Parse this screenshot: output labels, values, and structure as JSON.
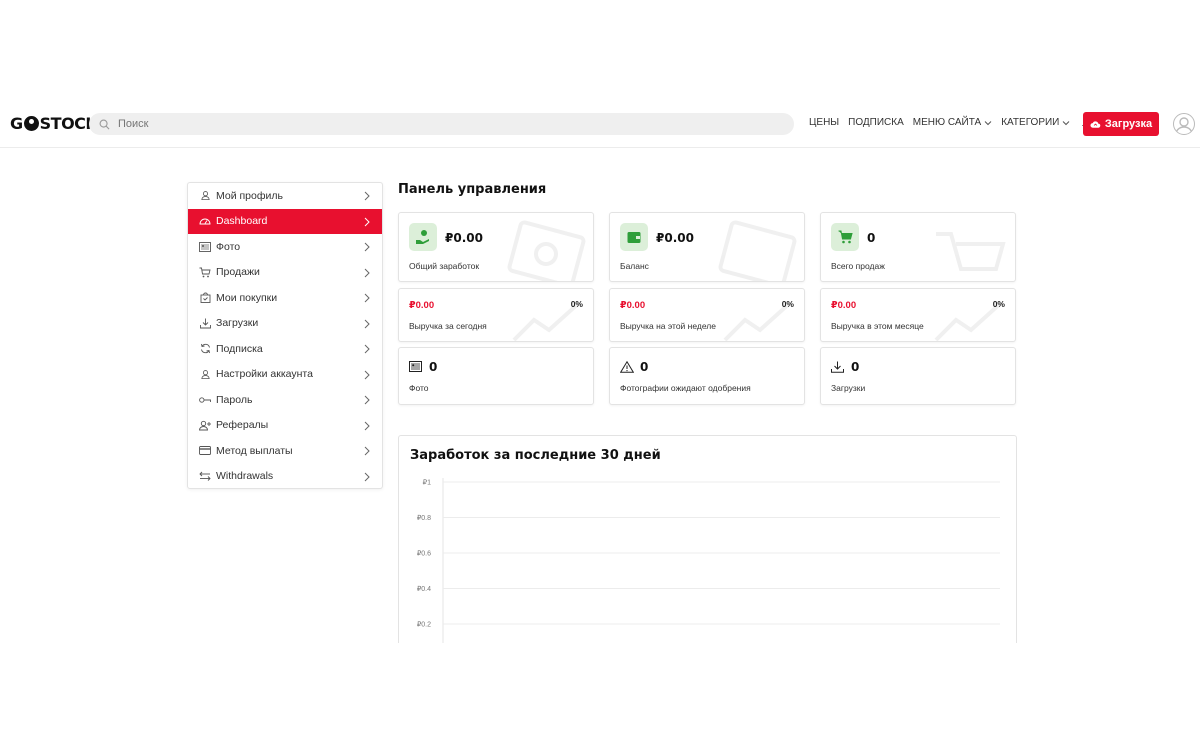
{
  "header": {
    "logo": {
      "left": "G",
      "right": "STOCK"
    },
    "search_placeholder": "Поиск",
    "nav": [
      {
        "label": "ЦЕНЫ",
        "dropdown": false
      },
      {
        "label": "ПОДПИСКА",
        "dropdown": false
      },
      {
        "label": "МЕНЮ САЙТА",
        "dropdown": true
      },
      {
        "label": "КАТЕГОРИИ",
        "dropdown": true
      }
    ],
    "upload_label": "Загрузка"
  },
  "sidebar": {
    "items": [
      {
        "label": "Мой профиль",
        "icon": "user-icon"
      },
      {
        "label": "Dashboard",
        "icon": "dashboard-icon",
        "active": true
      },
      {
        "label": "Фото",
        "icon": "image-icon"
      },
      {
        "label": "Продажи",
        "icon": "cart-icon"
      },
      {
        "label": "Мои покупки",
        "icon": "bag-icon"
      },
      {
        "label": "Загрузки",
        "icon": "download-icon"
      },
      {
        "label": "Подписка",
        "icon": "refresh-icon"
      },
      {
        "label": "Настройки аккаунта",
        "icon": "user-settings-icon"
      },
      {
        "label": "Пароль",
        "icon": "key-icon"
      },
      {
        "label": "Рефералы",
        "icon": "user-plus-icon"
      },
      {
        "label": "Метод выплаты",
        "icon": "credit-card-icon"
      },
      {
        "label": "Withdrawals",
        "icon": "transfer-icon"
      }
    ]
  },
  "main": {
    "title": "Панель управления",
    "stats": [
      {
        "value": "₽0.00",
        "label": "Общий заработок",
        "icon": "money-hand-icon"
      },
      {
        "value": "₽0.00",
        "label": "Баланс",
        "icon": "wallet-icon"
      },
      {
        "value": "0",
        "label": "Всего продаж",
        "icon": "cart-icon"
      }
    ],
    "revenue": [
      {
        "value": "₽0.00",
        "percent": "0%",
        "label": "Выручка за сегодня"
      },
      {
        "value": "₽0.00",
        "percent": "0%",
        "label": "Выручка на этой неделе"
      },
      {
        "value": "₽0.00",
        "percent": "0%",
        "label": "Выручка в этом месяце"
      }
    ],
    "counts": [
      {
        "value": "0",
        "label": "Фото",
        "icon": "image-icon"
      },
      {
        "value": "0",
        "label": "Фотографии ожидают одобрения",
        "icon": "warning-icon"
      },
      {
        "value": "0",
        "label": "Загрузки",
        "icon": "download-icon"
      }
    ]
  },
  "colors": {
    "accent": "#e8102f",
    "success_bg": "#dcefd9",
    "success": "#2f9e3a"
  },
  "chart_data": {
    "type": "line",
    "title": "Заработок за последние 30 дней",
    "y_ticks": [
      "₽1",
      "₽0.8",
      "₽0.6",
      "₽0.4",
      "₽0.2"
    ],
    "ylim": [
      0,
      1
    ],
    "grid": true,
    "series": []
  }
}
